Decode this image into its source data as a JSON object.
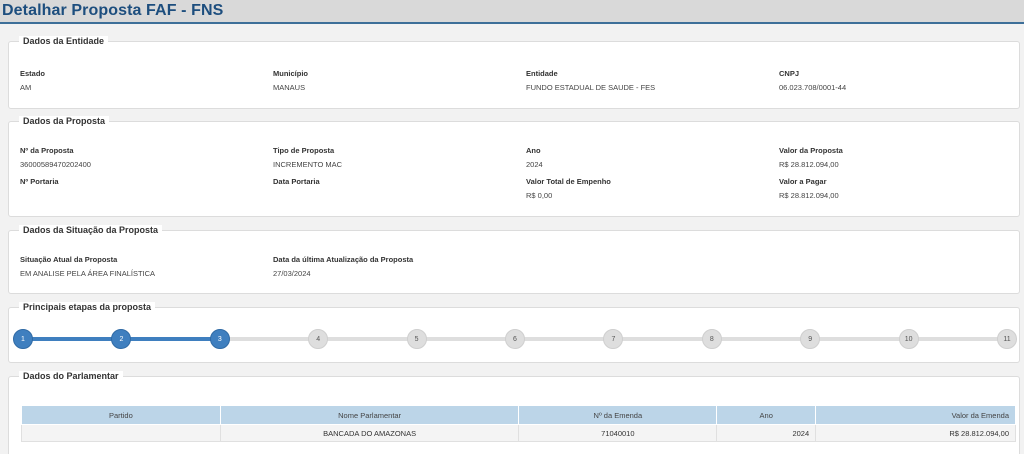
{
  "page": {
    "title": "Detalhar Proposta FAF - FNS"
  },
  "entidade": {
    "legend": "Dados da Entidade",
    "fields": [
      {
        "label": "Estado",
        "value": "AM"
      },
      {
        "label": "Município",
        "value": "MANAUS"
      },
      {
        "label": "Entidade",
        "value": "FUNDO ESTADUAL DE SAUDE - FES"
      },
      {
        "label": "CNPJ",
        "value": "06.023.708/0001-44"
      }
    ]
  },
  "proposta": {
    "legend": "Dados da Proposta",
    "fields": [
      {
        "label": "Nº da Proposta",
        "value": "36000589470202400"
      },
      {
        "label": "Tipo de Proposta",
        "value": "INCREMENTO MAC"
      },
      {
        "label": "Ano",
        "value": "2024"
      },
      {
        "label": "Valor da Proposta",
        "value": "R$ 28.812.094,00"
      },
      {
        "label": "Nº Portaria",
        "value": ""
      },
      {
        "label": "Data Portaria",
        "value": ""
      },
      {
        "label": "Valor Total de Empenho",
        "value": "R$ 0,00"
      },
      {
        "label": "Valor a Pagar",
        "value": "R$ 28.812.094,00"
      }
    ]
  },
  "situacao": {
    "legend": "Dados da Situação da Proposta",
    "fields": [
      {
        "label": "Situação Atual da Proposta",
        "value": "EM ANALISE PELA ÁREA FINALÍSTICA"
      },
      {
        "label": "Data da última Atualização da Proposta",
        "value": "27/03/2024"
      }
    ]
  },
  "etapas": {
    "legend": "Principais etapas da proposta",
    "current_step": 3,
    "steps": [
      "1",
      "2",
      "3",
      "4",
      "5",
      "6",
      "7",
      "8",
      "9",
      "10",
      "11"
    ],
    "colors": {
      "done": "#3f7fbf",
      "todo": "#dedede"
    }
  },
  "parlamentar": {
    "legend": "Dados do Parlamentar",
    "columns": [
      "Partido",
      "Nome Parlamentar",
      "Nº da Emenda",
      "Ano",
      "Valor da Emenda"
    ],
    "rows": [
      [
        "",
        "BANCADA DO AMAZONAS",
        "71040010",
        "2024",
        "R$ 28.812.094,00"
      ]
    ]
  }
}
